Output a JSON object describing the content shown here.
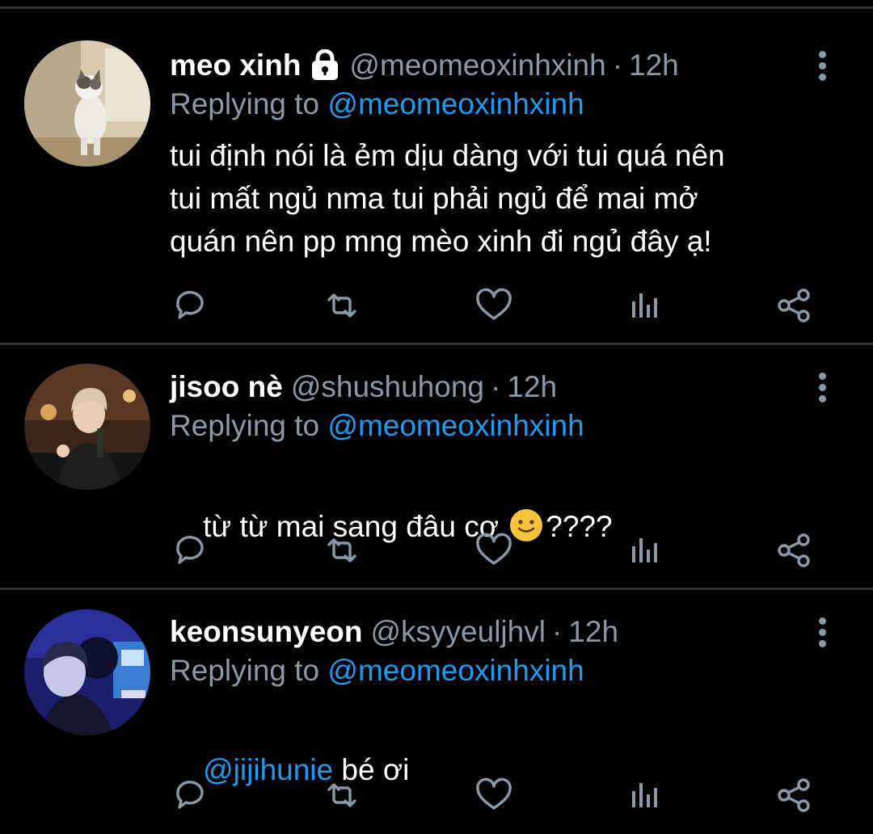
{
  "replying_label": "Replying to",
  "tweets": [
    {
      "name": "meo xinh",
      "protected": true,
      "handle": "@meomeoxinhxinh",
      "separator": "·",
      "time": "12h",
      "replying_to": "@meomeoxinhxinh",
      "text_lines": [
        "tui định nói là ẻm dịu dàng với tui quá nên",
        "tui mất ngủ nma tui phải ngủ để mai mở",
        "quán nên pp mng mèo xinh đi ngủ đây ạ!"
      ],
      "avatar": "cat-avatar"
    },
    {
      "name": "jisoo nè",
      "protected": false,
      "handle": "@shushuhong",
      "separator": "·",
      "time": "12h",
      "replying_to": "@meomeoxinhxinh",
      "text_before_emoji": "từ từ mai sang đâu cơ ",
      "emoji": "slightly-smiling-face",
      "text_after_emoji": "????",
      "avatar": "person-avatar"
    },
    {
      "name": "keonsunyeon",
      "protected": false,
      "handle": "@ksyyeuljhvl",
      "separator": "·",
      "time": "12h",
      "replying_to": "@meomeoxinhxinh",
      "body_mention": "@jijihunie",
      "body_text": " bé ơi",
      "avatar": "person-avatar-blue"
    }
  ],
  "action_icons": [
    "reply-icon",
    "retweet-icon",
    "like-icon",
    "analytics-icon",
    "share-icon"
  ],
  "colors": {
    "background": "#000000",
    "text": "#ffffff",
    "muted": "#8b98a5",
    "link": "#1d9bf0",
    "divider": "#2f3336"
  }
}
